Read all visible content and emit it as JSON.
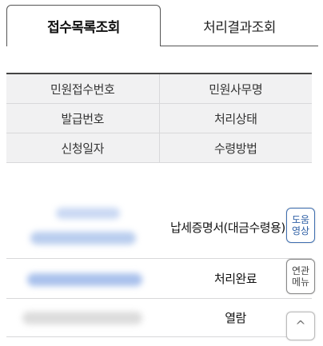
{
  "tabs": {
    "active_label": "접수목록조회",
    "inactive_label": "처리결과조회"
  },
  "header": {
    "rows": [
      [
        "민원접수번호",
        "민원사무명"
      ],
      [
        "발급번호",
        "처리상태"
      ],
      [
        "신청일자",
        "수령방법"
      ]
    ]
  },
  "record": {
    "civil_affair_name": "납세증명서(대금수령용)",
    "status": "처리완료",
    "receipt_method": "열람"
  },
  "side_buttons": {
    "help_line1": "도움",
    "help_line2": "영상",
    "related_line1": "연관",
    "related_line2": "메뉴",
    "top_glyph": "^"
  },
  "colors": {
    "accent": "#2e5fa5",
    "header_bg": "#f1f1f2"
  }
}
